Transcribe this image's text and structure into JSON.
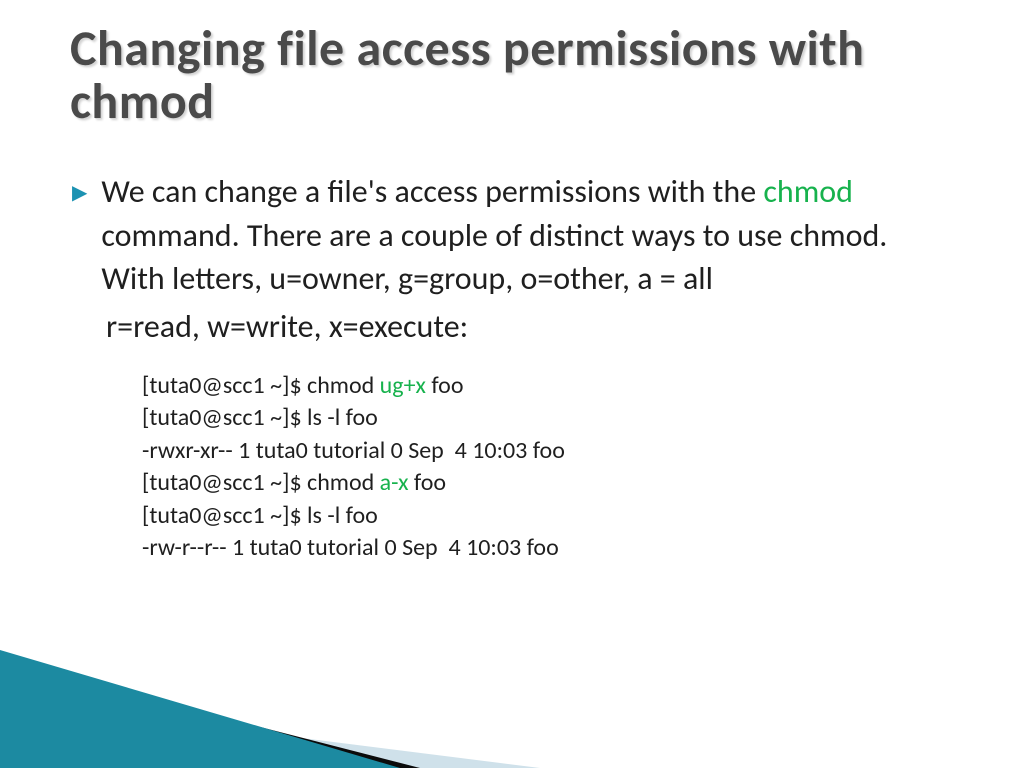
{
  "title": "Changing file access permissions with chmod",
  "bullet": {
    "pre": "We can change a file's access permissions with the ",
    "cmd": "chmod",
    "post": " command.  There are a couple of distinct ways to use chmod.  With letters, u=owner, g=group, o=other, a = all"
  },
  "line2": "r=read,    w=write,  x=execute:",
  "term": {
    "l1a": "[tuta0@scc1 ~]$ chmod ",
    "l1b": "ug+x",
    "l1c": " foo",
    "l2": "[tuta0@scc1 ~]$ ls -l foo",
    "l3": "-rwxr-xr-- 1 tuta0 tutorial 0 Sep  4 10:03 foo",
    "l4a": "[tuta0@scc1 ~]$ chmod ",
    "l4b": "a-x",
    "l4c": " foo",
    "l5": "[tuta0@scc1 ~]$ ls -l foo",
    "l6": "-rw-r--r-- 1 tuta0 tutorial 0 Sep  4 10:03 foo"
  }
}
